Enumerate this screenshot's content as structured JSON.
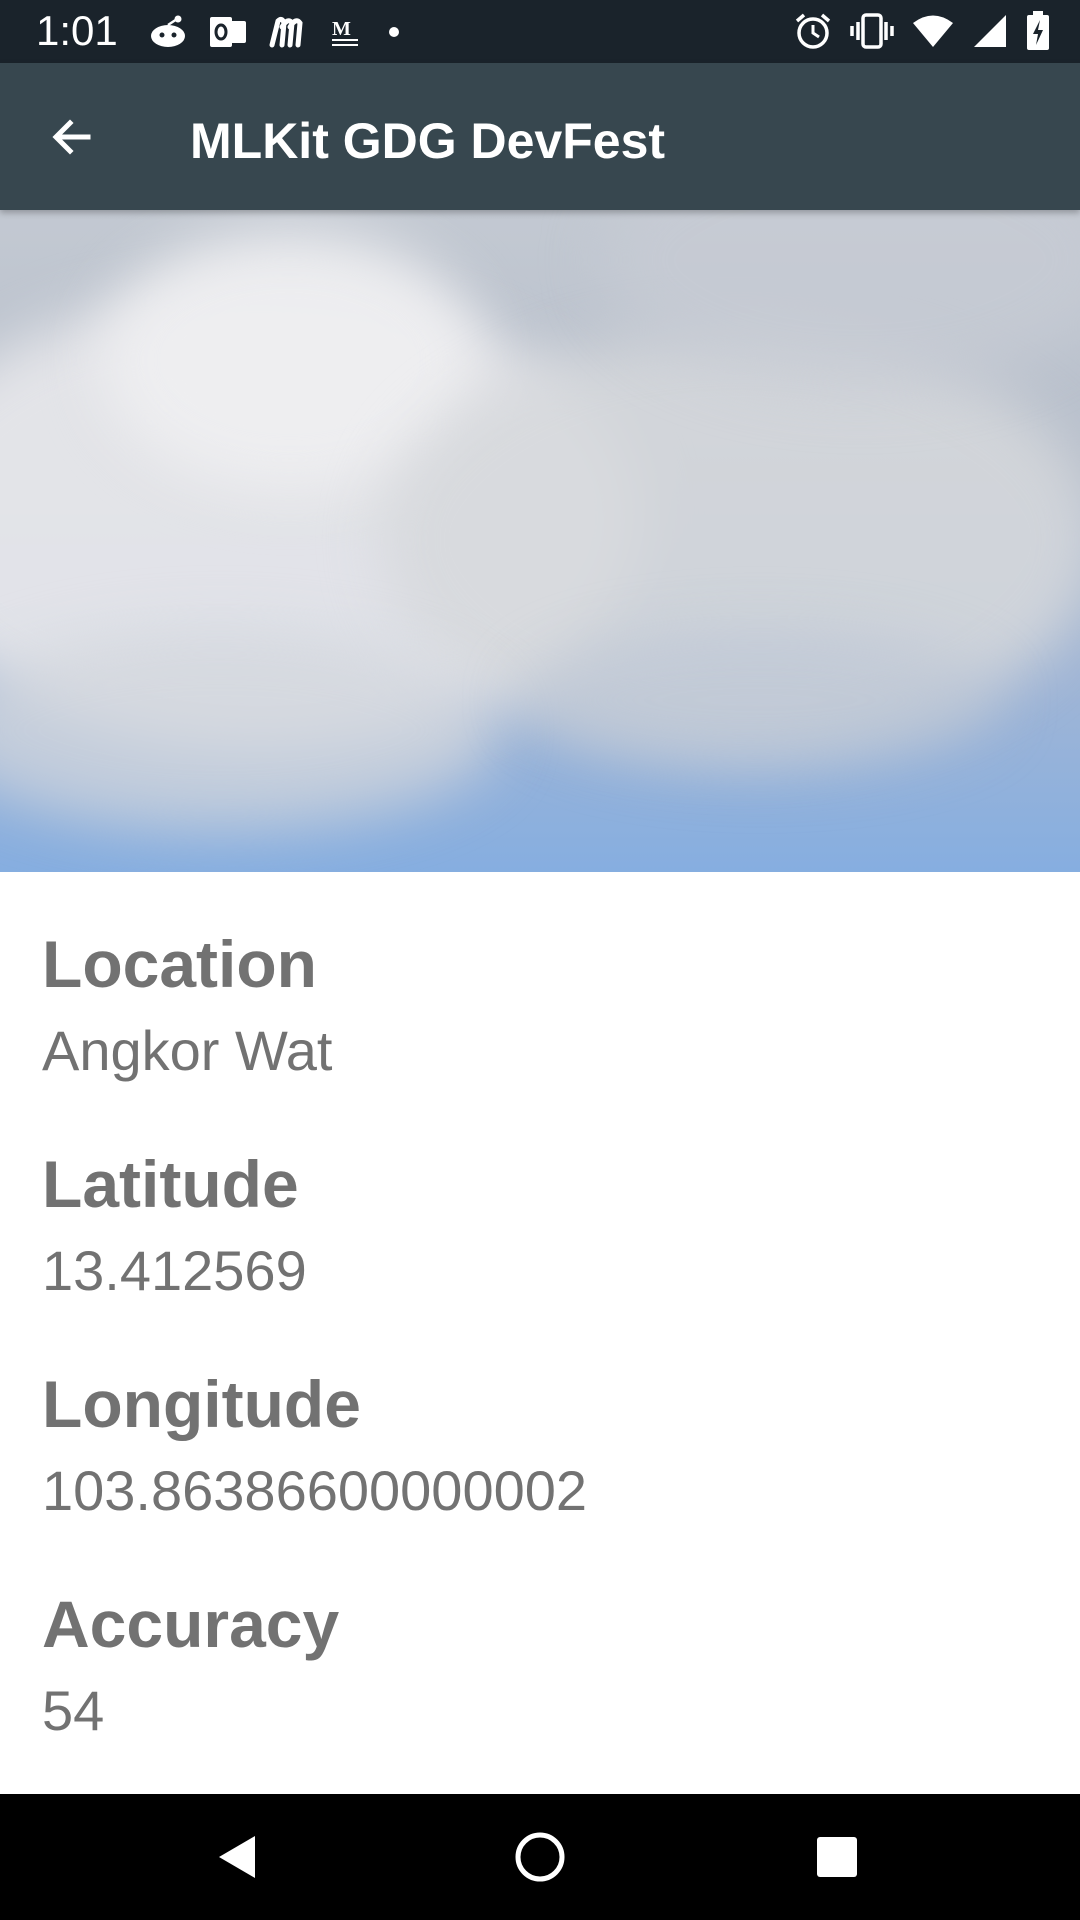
{
  "status_bar": {
    "time": "1:01",
    "left_icons": [
      "reddit-icon",
      "outlook-icon",
      "m-app-icon",
      "gmail-news-icon",
      "dot-icon"
    ],
    "right_icons": [
      "alarm-icon",
      "vibrate-icon",
      "wifi-icon",
      "signal-icon",
      "battery-charging-icon"
    ]
  },
  "app_bar": {
    "title": "MLKit GDG DevFest",
    "back_icon": "arrow-back-icon",
    "background": "#37474f"
  },
  "details": {
    "location": {
      "label": "Location",
      "value": "Angkor Wat"
    },
    "latitude": {
      "label": "Latitude",
      "value": "13.412569"
    },
    "longitude": {
      "label": "Longitude",
      "value": "103.86386600000002"
    },
    "accuracy": {
      "label": "Accuracy",
      "value": "54"
    }
  },
  "nav_bar": {
    "icons": [
      "back-triangle-icon",
      "home-circle-icon",
      "recents-square-icon"
    ]
  },
  "colors": {
    "status_bar": "#1a232b",
    "text_secondary": "#727272"
  }
}
